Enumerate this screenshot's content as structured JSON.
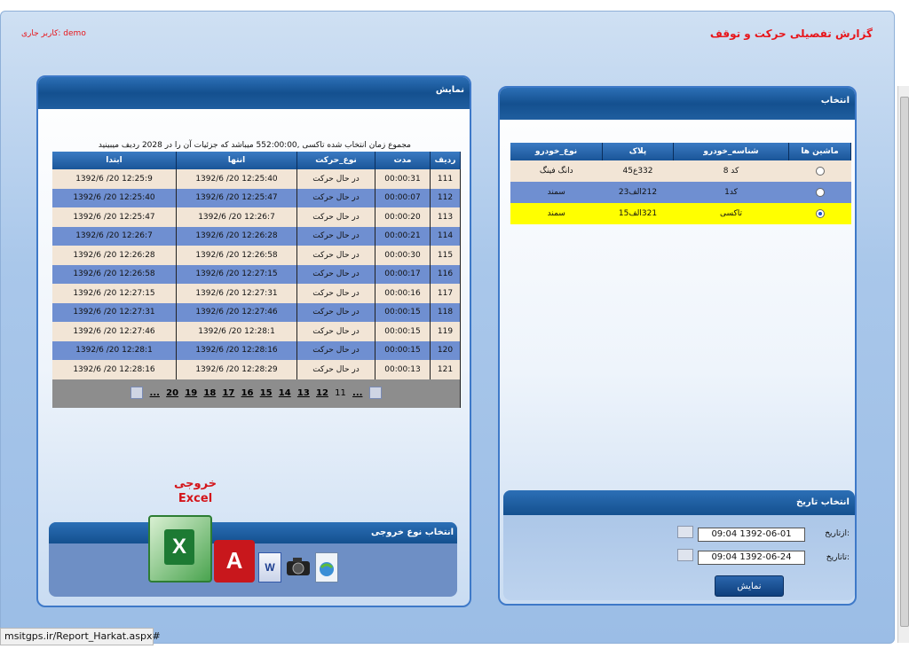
{
  "header": {
    "title": "گزارش تفصیلی حرکت و توقف",
    "current_user": "کاربر جاری: demo"
  },
  "left_panel": {
    "title": "نمایش",
    "summary": "مجموع زمان انتخاب شده تاکسی ,552:00:00 میباشد که جزئیات آن را در 2028 ردیف میبینید",
    "columns": [
      "ردیف",
      "مدت",
      "نوع_حرکت",
      "انتها",
      "ابتدا"
    ],
    "rows": [
      {
        "id": "111",
        "duration": "00:00:31",
        "type": "در حال حرکت",
        "end": "12:25:40 20/ 1392/6",
        "start": "12:25:9 20/ 1392/6"
      },
      {
        "id": "112",
        "duration": "00:00:07",
        "type": "در حال حرکت",
        "end": "12:25:47 20/ 1392/6",
        "start": "12:25:40 20/ 1392/6"
      },
      {
        "id": "113",
        "duration": "00:00:20",
        "type": "در حال حرکت",
        "end": "12:26:7 20/ 1392/6",
        "start": "12:25:47 20/ 1392/6"
      },
      {
        "id": "114",
        "duration": "00:00:21",
        "type": "در حال حرکت",
        "end": "12:26:28 20/ 1392/6",
        "start": "12:26:7 20/ 1392/6"
      },
      {
        "id": "115",
        "duration": "00:00:30",
        "type": "در حال حرکت",
        "end": "12:26:58 20/ 1392/6",
        "start": "12:26:28 20/ 1392/6"
      },
      {
        "id": "116",
        "duration": "00:00:17",
        "type": "در حال حرکت",
        "end": "12:27:15 20/ 1392/6",
        "start": "12:26:58 20/ 1392/6"
      },
      {
        "id": "117",
        "duration": "00:00:16",
        "type": "در حال حرکت",
        "end": "12:27:31 20/ 1392/6",
        "start": "12:27:15 20/ 1392/6"
      },
      {
        "id": "118",
        "duration": "00:00:15",
        "type": "در حال حرکت",
        "end": "12:27:46 20/ 1392/6",
        "start": "12:27:31 20/ 1392/6"
      },
      {
        "id": "119",
        "duration": "00:00:15",
        "type": "در حال حرکت",
        "end": "12:28:1 20/ 1392/6",
        "start": "12:27:46 20/ 1392/6"
      },
      {
        "id": "120",
        "duration": "00:00:15",
        "type": "در حال حرکت",
        "end": "12:28:16 20/ 1392/6",
        "start": "12:28:1 20/ 1392/6"
      },
      {
        "id": "121",
        "duration": "00:00:13",
        "type": "در حال حرکت",
        "end": "12:28:29 20/ 1392/6",
        "start": "12:28:16 20/ 1392/6"
      }
    ],
    "pager": {
      "prev_more": "...",
      "pages": [
        "11",
        "12",
        "13",
        "14",
        "15",
        "16",
        "17",
        "18",
        "19",
        "20"
      ],
      "next_more": "..."
    },
    "output": {
      "caption_line1": "خروجی",
      "caption_line2": "Excel",
      "title": "انتخاب نوع خروجی",
      "excel_letter": "X",
      "pdf_letter": "A",
      "word_letter": "W"
    }
  },
  "right_panel": {
    "title": "انتخاب",
    "columns": [
      "ماشین ها",
      "شناسه_خودرو",
      "پلاک",
      "نوع_خودرو"
    ],
    "vehicles": [
      {
        "selected": false,
        "id": "کد 8",
        "plate": "332ع45",
        "kind": "دانگ فینگ"
      },
      {
        "selected": false,
        "id": "کد1",
        "plate": "212الف23",
        "kind": "سمند"
      },
      {
        "selected": true,
        "id": "تاکسی",
        "plate": "321الف15",
        "kind": "سمند"
      }
    ],
    "date": {
      "title": "انتخاب تاریخ",
      "from_label": "ازتاریخ:",
      "from_value": "09:04 1392-06-01",
      "to_label": "تاتاریخ:",
      "to_value": "09:04 1392-06-24",
      "show_label": "نمایش"
    }
  },
  "status_bar": "msitgps.ir/Report_Harkat.aspx#",
  "colors": {
    "accent": "#1a5598",
    "title_red": "#e8151a",
    "selected_row": "#ffff00"
  }
}
